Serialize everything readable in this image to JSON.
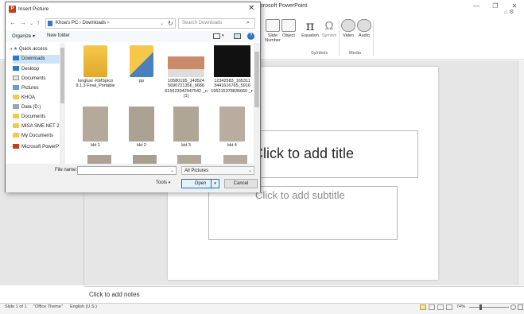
{
  "app": {
    "title": "Microsoft PowerPoint",
    "window_buttons": [
      "—",
      "❐",
      "✕"
    ]
  },
  "ribbon": {
    "buttons": [
      {
        "label": "Slide Number"
      },
      {
        "label": "Object"
      },
      {
        "label": "Equation",
        "glyph": "π"
      },
      {
        "label": "Symbol",
        "glyph": "Ω"
      },
      {
        "label": "Video"
      },
      {
        "label": "Audio"
      }
    ],
    "partial_label": "e",
    "groups": [
      "Symbols",
      "Media"
    ]
  },
  "slide": {
    "title_placeholder": "Click to add title",
    "subtitle_placeholder": "Click to add subtitle"
  },
  "notes": {
    "placeholder": "Click to add notes"
  },
  "status": {
    "slide": "Slide 1 of 1",
    "theme": "\"Office Theme\"",
    "language": "English (U.S.)",
    "zoom": "74%"
  },
  "dialog": {
    "title": "Insert Picture",
    "address": "Khoa's PC  ›  Downloads  ›",
    "search_placeholder": "Search Downloads",
    "organize": "Organize ▾",
    "new_folder": "New folder",
    "nav_items": [
      {
        "label": "Quick access",
        "icon": "star-icon"
      },
      {
        "label": "Downloads",
        "icon": "download-icon",
        "selected": true
      },
      {
        "label": "Desktop",
        "icon": "desktop-icon"
      },
      {
        "label": "Documents",
        "icon": "document-icon"
      },
      {
        "label": "Pictures",
        "icon": "picture-icon"
      },
      {
        "label": "KHOA",
        "icon": "folder-icon"
      },
      {
        "label": "Data (D:)",
        "icon": "drive-icon"
      },
      {
        "label": "Documents",
        "icon": "folder-icon"
      },
      {
        "label": "MISA SME.NET 2",
        "icon": "folder-icon"
      },
      {
        "label": "My Documents",
        "icon": "folder-icon"
      },
      {
        "label": "Microsoft PowerP",
        "icon": "powerpoint-icon"
      }
    ],
    "files": [
      {
        "name": "longluxi -KMSpico 9.1.3 Final_Portable",
        "kind": "folder"
      },
      {
        "name": "pp",
        "kind": "folder"
      },
      {
        "name": "10580195_149524 5690721356_6688 615623042947542 _n (1)",
        "kind": "image"
      },
      {
        "name": "12342583_165311 3441616765_5916 195215378836660 _n",
        "kind": "image-dark"
      },
      {
        "name": "kkt 1",
        "kind": "scan"
      },
      {
        "name": "kkt 2",
        "kind": "scan"
      },
      {
        "name": "kkt 3",
        "kind": "scan"
      },
      {
        "name": "kkt 4",
        "kind": "scan"
      }
    ],
    "file_name_label": "File name:",
    "file_name_value": "",
    "file_type": "All Pictures",
    "tools": "Tools",
    "open": "Open",
    "cancel": "Cancel"
  }
}
